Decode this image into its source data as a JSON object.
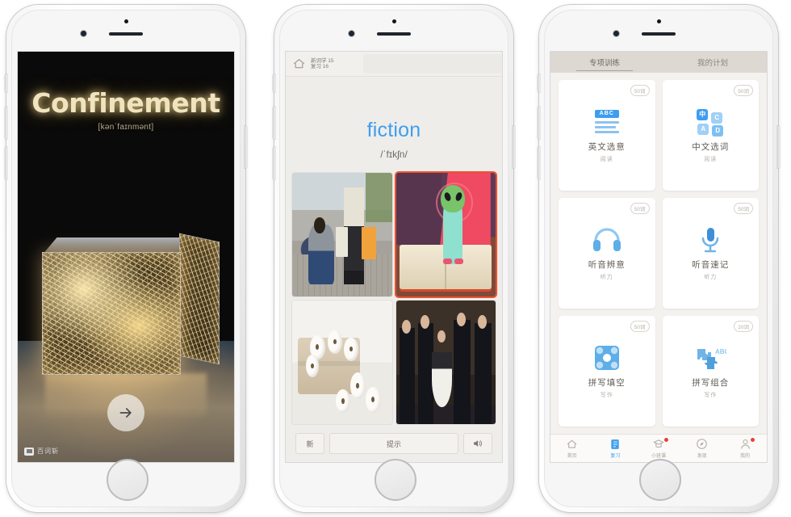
{
  "screen1": {
    "word": "Confinement",
    "phonetic": "[kənˈfaɪnmənt]",
    "next_button_icon": "arrow-right-icon",
    "brand_name": "百词斩",
    "brand_mark_icon": "app-logo-icon"
  },
  "screen2": {
    "header": {
      "home_icon": "home-icon",
      "new_words_count": "新词学 15",
      "review_count": "复习 16"
    },
    "word": "fiction",
    "phonetic": "/ˈfɪkʃn/",
    "images": [
      {
        "name": "street-couple-photo",
        "selected": false
      },
      {
        "name": "alien-on-book-illustration",
        "selected": true
      },
      {
        "name": "cotton-bolls-photo",
        "selected": false
      },
      {
        "name": "group-people-photo",
        "selected": false
      }
    ],
    "buttons": {
      "new_label": "新",
      "hint_label": "提示",
      "speaker_icon": "speaker-icon"
    }
  },
  "screen3": {
    "tabs": [
      {
        "label": "专项训练",
        "active": true
      },
      {
        "label": "我的计划",
        "active": false
      }
    ],
    "cards": [
      {
        "title": "英文选意",
        "sub": "阅读",
        "badge": "50词",
        "icon": "abc-list-icon",
        "icon_text": "ABC"
      },
      {
        "title": "中文选词",
        "sub": "阅读",
        "badge": "50词",
        "icon": "letter-tiles-icon",
        "icon_text": "中"
      },
      {
        "title": "听音辨意",
        "sub": "听力",
        "badge": "50词",
        "icon": "headphones-icon"
      },
      {
        "title": "听音速记",
        "sub": "听力",
        "badge": "50词",
        "icon": "microphone-icon"
      },
      {
        "title": "拼写填空",
        "sub": "写作",
        "badge": "50词",
        "icon": "puzzle-grid-icon"
      },
      {
        "title": "拼写组合",
        "sub": "写作",
        "badge": "20词",
        "icon": "puzzle-abc-icon",
        "icon_text": "ABC"
      }
    ],
    "tabbar": [
      {
        "label": "首页",
        "icon": "home-icon",
        "active": false,
        "badge": false
      },
      {
        "label": "复习",
        "icon": "book-icon",
        "active": true,
        "badge": false
      },
      {
        "label": "小班课",
        "icon": "class-icon",
        "active": false,
        "badge": true
      },
      {
        "label": "发现",
        "icon": "discover-icon",
        "active": false,
        "badge": false
      },
      {
        "label": "我的",
        "icon": "profile-icon",
        "active": false,
        "badge": true
      }
    ]
  },
  "colors": {
    "accent_blue": "#3d9ef0",
    "selection_red": "#f0502e",
    "badge_red": "#ec3b3b",
    "word_gold": "#efe3c0"
  }
}
